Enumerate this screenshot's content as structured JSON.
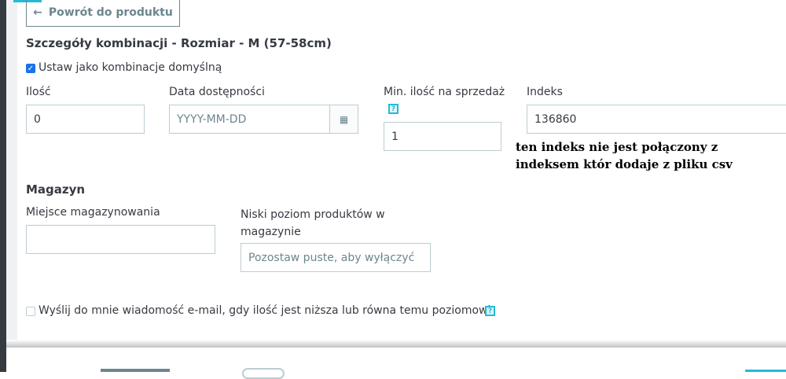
{
  "back_button": {
    "label": "Powrót do produktu"
  },
  "section_title": "Szczegóły kombinacji - Rozmiar - M (57-58cm)",
  "default_checkbox": {
    "label": "Ustaw jako kombinacje domyślną",
    "checked": true
  },
  "fields": {
    "quantity": {
      "label": "Ilość",
      "value": "0"
    },
    "availability_date": {
      "label": "Data dostępności",
      "placeholder": "YYYY-MM-DD"
    },
    "min_quantity": {
      "label": "Min. ilość na sprzedaż",
      "value": "1",
      "help": "?"
    },
    "reference": {
      "label": "Indeks",
      "value": "136860"
    }
  },
  "annotation": {
    "line1": "ten indeks nie jest połączony z",
    "line2": "indeksem któr dodaje z pliku csv"
  },
  "warehouse": {
    "title": "Magazyn",
    "location": {
      "label": "Miejsce magazynowania",
      "value": ""
    },
    "low_stock": {
      "label": "Niski poziom produktów w magazynie",
      "placeholder": "Pozostaw puste, aby wyłączyć"
    }
  },
  "email_checkbox": {
    "label": "Wyślij do mnie wiadomość e-mail, gdy ilość jest niższa lub równa temu poziomowi",
    "checked": false,
    "help": "?"
  }
}
